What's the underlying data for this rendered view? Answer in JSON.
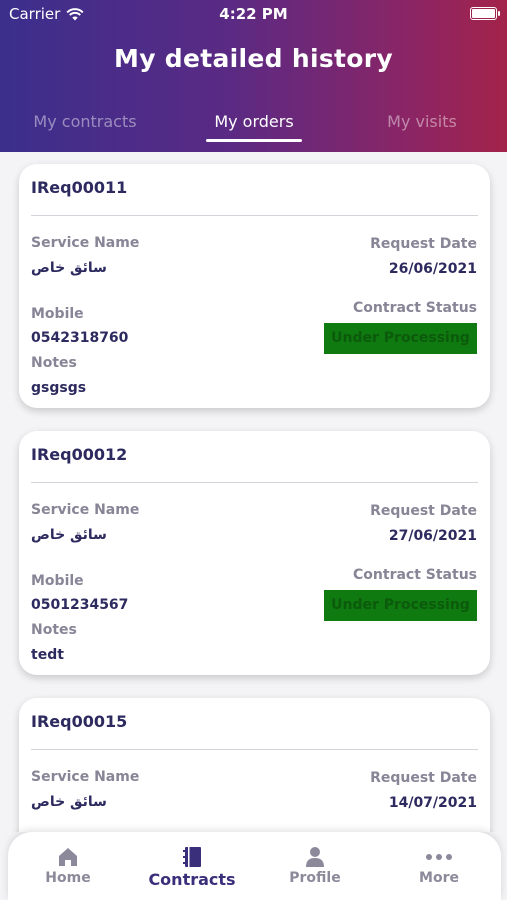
{
  "status_bar": {
    "carrier": "Carrier",
    "time": "4:22 PM"
  },
  "header": {
    "title": "My detailed history"
  },
  "tabs": [
    {
      "label": "My contracts",
      "active": false
    },
    {
      "label": "My orders",
      "active": true
    },
    {
      "label": "My visits",
      "active": false
    }
  ],
  "labels": {
    "service_name": "Service Name",
    "request_date": "Request Date",
    "mobile": "Mobile",
    "contract_status": "Contract Status",
    "notes": "Notes"
  },
  "orders": [
    {
      "id": "IReq00011",
      "service_name": "سائق خاص",
      "request_date": "26/06/2021",
      "mobile": "0542318760",
      "contract_status": "Under Processing",
      "notes": "gsgsgs"
    },
    {
      "id": "IReq00012",
      "service_name": "سائق خاص",
      "request_date": "27/06/2021",
      "mobile": "0501234567",
      "contract_status": "Under Processing",
      "notes": "tedt"
    },
    {
      "id": "IReq00015",
      "service_name": "سائق خاص",
      "request_date": "14/07/2021"
    }
  ],
  "bottom_nav": [
    {
      "label": "Home",
      "icon": "home-icon",
      "active": false
    },
    {
      "label": "Contracts",
      "icon": "contracts-icon",
      "active": true
    },
    {
      "label": "Profile",
      "icon": "profile-icon",
      "active": false
    },
    {
      "label": "More",
      "icon": "more-dots-icon",
      "active": false
    }
  ],
  "colors": {
    "accent": "#3b2f8c",
    "gradient_end": "#a3234a",
    "status_green": "#0f7a0f",
    "text_dark": "#2c2a5e",
    "label_gray": "#878596"
  }
}
